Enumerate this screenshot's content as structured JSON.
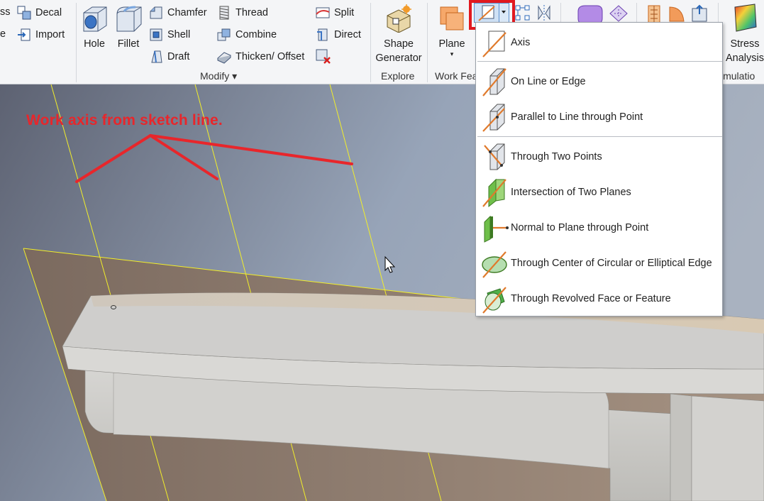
{
  "ribbon": {
    "create_column": {
      "top_partial": "ss",
      "mid_partial": "e"
    },
    "small_buttons": {
      "decal": "Decal",
      "import": "Import",
      "chamfer": "Chamfer",
      "shell": "Shell",
      "draft": "Draft",
      "thread": "Thread",
      "combine": "Combine",
      "thicken_offset": "Thicken/ Offset",
      "split": "Split",
      "direct": "Direct"
    },
    "big_buttons": {
      "hole": "Hole",
      "fillet": "Fillet",
      "shape_generator_1": "Shape",
      "shape_generator_2": "Generator",
      "plane": "Plane",
      "stress_1": "Stress",
      "stress_2": "Analysis"
    },
    "panels": {
      "modify": "Modify ▾",
      "explore": "Explore",
      "work_features": "Work Fea",
      "simulation": "imulatio"
    }
  },
  "annotation": "Work axis from sketch line.",
  "dropdown": {
    "items": [
      {
        "label": "Axis",
        "icon": "axis-icon"
      },
      {
        "label": "On Line or Edge",
        "icon": "on-line-edge-icon"
      },
      {
        "label": "Parallel to Line  through Point",
        "icon": "parallel-line-point-icon"
      },
      {
        "label": "Through Two Points",
        "icon": "two-points-icon"
      },
      {
        "label": "Intersection of Two Planes",
        "icon": "two-planes-icon"
      },
      {
        "label": "Normal to Plane through Point",
        "icon": "normal-plane-point-icon"
      },
      {
        "label": "Through Center of Circular or Elliptical Edge",
        "icon": "circular-edge-icon"
      },
      {
        "label": "Through Revolved Face or Feature",
        "icon": "revolved-face-icon"
      }
    ]
  },
  "colors": {
    "annotation_red": "#e8262b",
    "highlight_red": "#e1191f",
    "axis_orange": "#e07a2c",
    "sketch_yellow": "#f2ee2a"
  }
}
